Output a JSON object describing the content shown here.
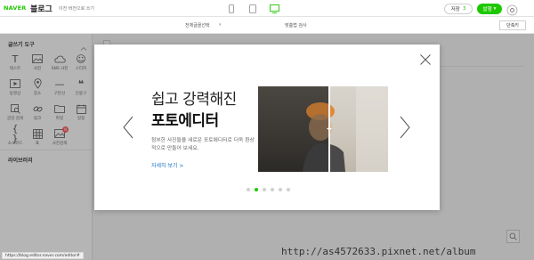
{
  "header": {
    "logo_naver": "NAVER",
    "logo_blog": "블로그",
    "old_version": "이전 버전으로 쓰기",
    "save_label": "저장",
    "save_count": "3",
    "publish_label": "발행"
  },
  "subbar": {
    "select_all": "전체글꼴선택",
    "spell_check": "맞춤법 검사",
    "shortcut": "단축키"
  },
  "sidebar": {
    "title": "글쓰기 도구",
    "tools": [
      {
        "label": "텍스트",
        "icon": "text-icon"
      },
      {
        "label": "사진",
        "icon": "photo-icon"
      },
      {
        "label": "SNS 사진",
        "icon": "cloud-icon"
      },
      {
        "label": "스티커",
        "icon": "smile-icon"
      },
      {
        "label": "동영상",
        "icon": "video-icon"
      },
      {
        "label": "장소",
        "icon": "pin-icon"
      },
      {
        "label": "구분선",
        "icon": "divider-icon"
      },
      {
        "label": "인용구",
        "icon": "quote-icon"
      },
      {
        "label": "글감 검색",
        "icon": "search-icon"
      },
      {
        "label": "링크",
        "icon": "link-icon"
      },
      {
        "label": "파일",
        "icon": "folder-icon"
      },
      {
        "label": "일정",
        "icon": "calendar-icon"
      },
      {
        "label": "소스코드",
        "icon": "braces-icon"
      },
      {
        "label": "표",
        "icon": "table-icon"
      },
      {
        "label": "사진검색",
        "icon": "image-search-icon",
        "badge": "N"
      }
    ],
    "library": "라이브러리"
  },
  "modal": {
    "headline_line1": "쉽고 강력해진",
    "headline_line2": "포토에디터",
    "description": "첨부한 사진들을 새로운 포토에디터로 더욱 환상적으로 만들어 보세요.",
    "more_link": "자세히 보기 >",
    "total_slides": 6,
    "active_slide": 2
  },
  "status": {
    "url": "https://blog.editor.naver.com/editor#"
  },
  "watermark": "http://as4572633.pixnet.net/album",
  "colors": {
    "brand_green": "#1ec800",
    "link_blue": "#1a73c7",
    "badge_red": "#ff4b4b"
  }
}
